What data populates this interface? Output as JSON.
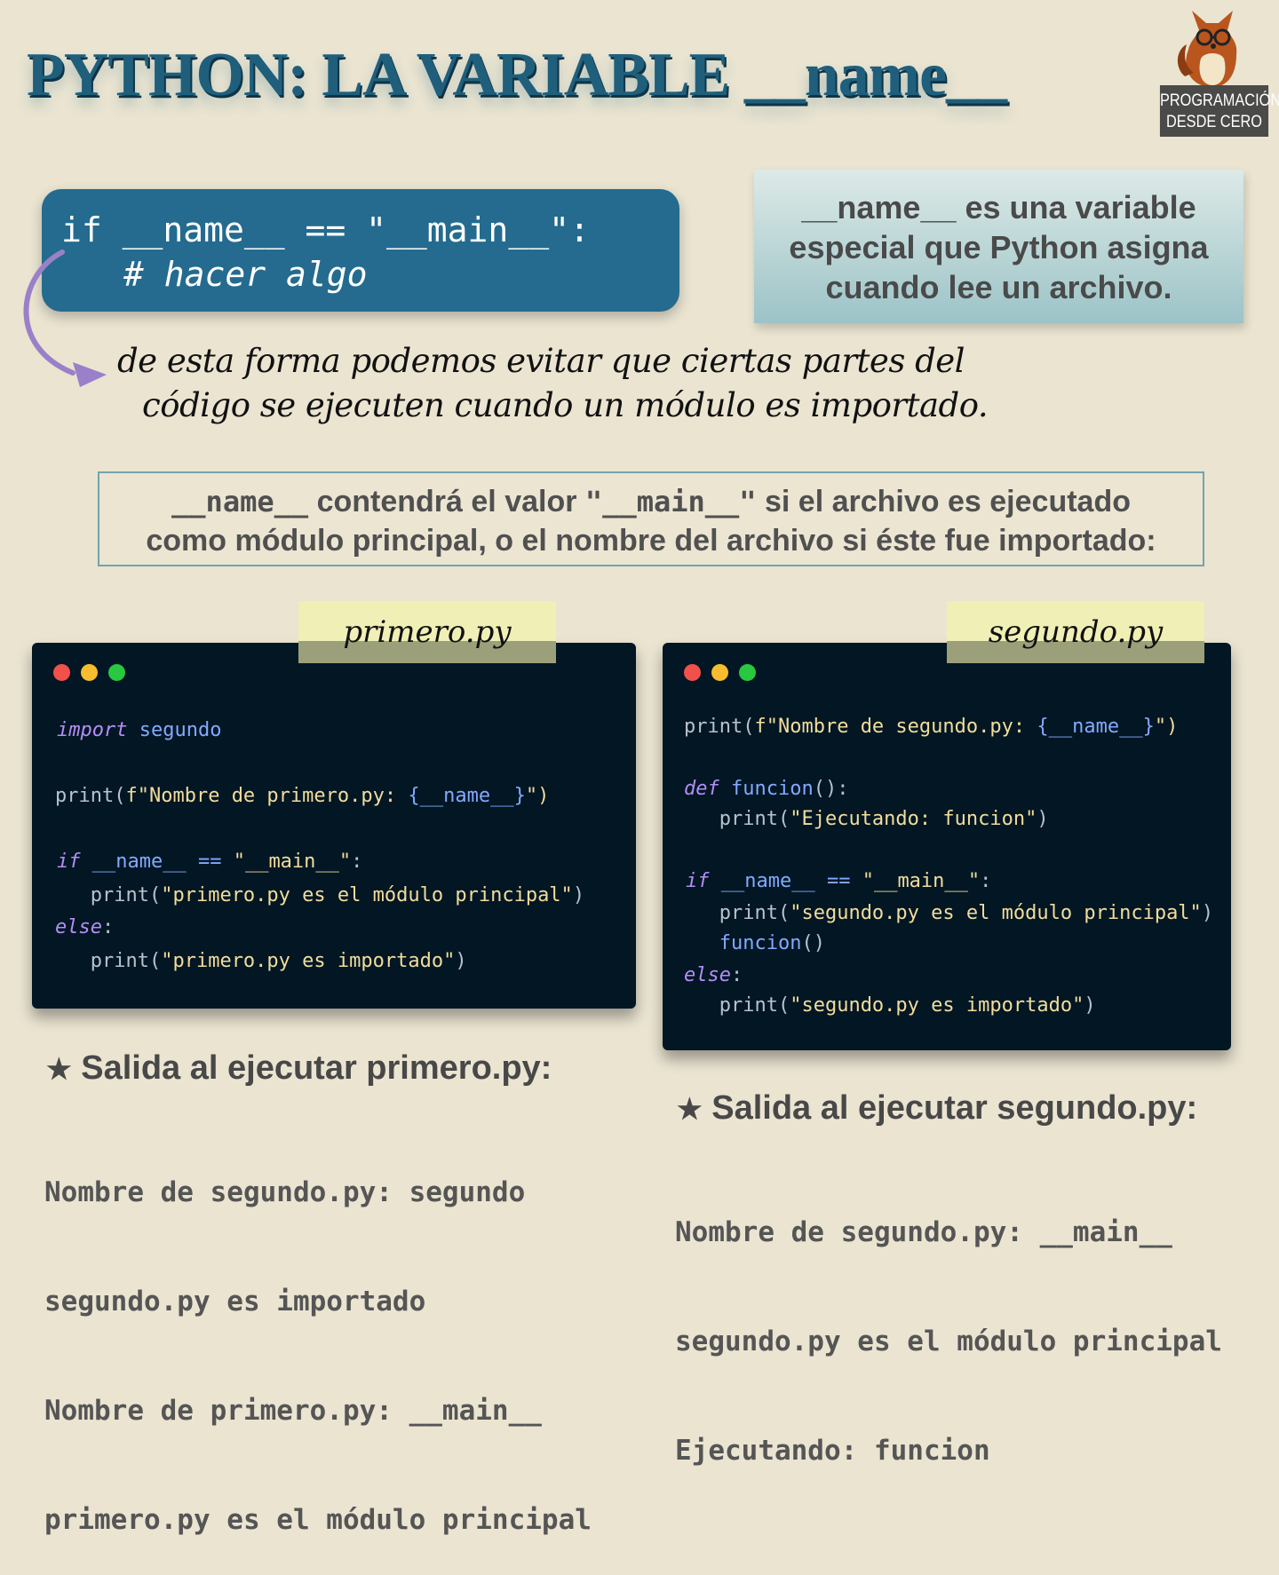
{
  "title": "PYTHON: LA VARIABLE __name__",
  "logo": {
    "line1": "PROGRAMACIÓN",
    "line2": "DESDE CERO",
    "icon": "fox-with-glasses-icon"
  },
  "code_box": {
    "line1": "if __name__ == \"__main__\":",
    "line2": "# hacer algo"
  },
  "info_box": {
    "lines": [
      "__name__ es una variable",
      "especial que Python asigna",
      "cuando lee un archivo."
    ]
  },
  "note": {
    "lines": [
      "de esta forma podemos evitar que ciertas partes del",
      "código se ejecuten cuando un módulo es importado."
    ]
  },
  "statement": {
    "p1": "__name__",
    "p2": " contendrá el valor ",
    "p3": "\"__main__\"",
    "p4": " si el archivo es ejecutado",
    "line2": "como módulo principal, o el nombre del archivo si éste fue importado:"
  },
  "file1": {
    "label": "primero.py",
    "code": {
      "l1_kw": "import",
      "l1_rest": " segundo",
      "l2_a": "print(",
      "l2_b": "f\"Nombre de primero.py: ",
      "l2_c": "{__name__}",
      "l2_d": "\")",
      "l3_kw": "if",
      "l3_a": " __name__",
      "l3_b": " == ",
      "l3_c": "\"__main__\"",
      "l3_d": ":",
      "l4_a": "   print(",
      "l4_b": "\"primero.py es el módulo principal\"",
      "l4_c": ")",
      "l5_kw": "else",
      "l5_d": ":",
      "l6_a": "   print(",
      "l6_b": "\"primero.py es importado\"",
      "l6_c": ")"
    }
  },
  "file2": {
    "label": "segundo.py",
    "code": {
      "l1_a": "print(",
      "l1_b": "f\"Nombre de segundo.py: ",
      "l1_c": "{__name__}",
      "l1_d": "\")",
      "l2_kw": "def",
      "l2_a": " funcion",
      "l2_b": "():",
      "l3_a": "   print(",
      "l3_b": "\"Ejecutando: funcion\"",
      "l3_c": ")",
      "l4_kw": "if",
      "l4_a": " __name__",
      "l4_b": " == ",
      "l4_c": "\"__main__\"",
      "l4_d": ":",
      "l5_a": "   print(",
      "l5_b": "\"segundo.py es el módulo principal\"",
      "l5_c": ")",
      "l6_a": "   funcion",
      "l6_b": "()",
      "l7_kw": "else",
      "l7_d": ":",
      "l8_a": "   print(",
      "l8_b": "\"segundo.py es importado\"",
      "l8_c": ")"
    }
  },
  "output1": {
    "star": "★",
    "heading": "Salida al ejecutar primero.py:",
    "lines": [
      "Nombre de segundo.py: segundo",
      "segundo.py es importado",
      "Nombre de primero.py: __main__",
      "primero.py es el módulo principal"
    ]
  },
  "output2": {
    "star": "★",
    "heading": "Salida al ejecutar segundo.py:",
    "lines": [
      "Nombre de segundo.py: __main__",
      "segundo.py es el módulo principal",
      "Ejecutando: funcion"
    ]
  },
  "colors": {
    "background": "#eae4d1",
    "title": "#1f5f7c",
    "code_box": "#246b8f",
    "window": "#031624",
    "keyword": "#b38ff5",
    "string": "#f1dd9b",
    "identifier": "#82aaff"
  }
}
